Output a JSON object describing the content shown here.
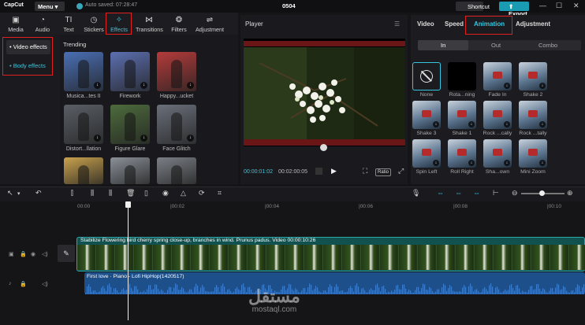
{
  "titlebar": {
    "logo": "CapCut",
    "menu": "Menu",
    "saved": "Auto saved: 07:28:47",
    "title": "0504",
    "shortcut": "Shortcut",
    "export": "Export",
    "min": "—",
    "max": "☐",
    "close": "✕"
  },
  "toolbar": {
    "items": [
      {
        "label": "Media",
        "icon": "media-icon"
      },
      {
        "label": "Audio",
        "icon": "audio-icon"
      },
      {
        "label": "Text",
        "icon": "text-icon"
      },
      {
        "label": "Stickers",
        "icon": "stickers-icon"
      },
      {
        "label": "Effects",
        "icon": "effects-icon",
        "active": true
      },
      {
        "label": "Transitions",
        "icon": "transitions-icon"
      },
      {
        "label": "Filters",
        "icon": "filters-icon"
      },
      {
        "label": "Adjustment",
        "icon": "adjustment-icon"
      }
    ]
  },
  "categories": [
    "• Video effects",
    "• Body effects"
  ],
  "effects": {
    "section": "Trending",
    "items": [
      {
        "label": "Musica...tes II",
        "color": "#4a6fb5"
      },
      {
        "label": "Firework",
        "color": "#5c6fb0"
      },
      {
        "label": "Happy...ucket",
        "color": "#b53b3b"
      },
      {
        "label": "Distort...llation",
        "color": "#5a5f66"
      },
      {
        "label": "Figure Glare",
        "color": "#4d6b3c"
      },
      {
        "label": "Face Glitch",
        "color": "#6a6f7a"
      },
      {
        "label": "",
        "color": "#c9a24d"
      },
      {
        "label": "",
        "color": "#8a9098"
      },
      {
        "label": "",
        "color": "#7b7f86"
      }
    ]
  },
  "player": {
    "title": "Player",
    "time_current": "00:00:01:02",
    "time_total": "00:02:00:05",
    "ratio": "Ratio"
  },
  "properties": {
    "tabs": [
      "Video",
      "Speed",
      "Animation",
      "Adjustment"
    ],
    "active_tab": "Animation",
    "segments": [
      "In",
      "Out",
      "Combo"
    ],
    "animations": [
      "None",
      "Rota...ning",
      "Fade In",
      "Shake 2",
      "Shake 3",
      "Shake 1",
      "Rock ...cally",
      "Rock ...tally",
      "Spin Left",
      "Roll Right",
      "Sha...own",
      "Mini Zoom"
    ]
  },
  "timeline": {
    "ticks": [
      "00:00",
      "|00:02",
      "|00:04",
      "|00:06",
      "|00:08",
      "|00:10"
    ],
    "video_label": "Stabilize   Flowering bird cherry spring close-up, branches in wind. Prunus padus. Video   00:00:10:26",
    "audio_label": "First love  · Piano - Lofi HipHop(1420517)"
  },
  "watermark": {
    "arabic": "مستقل",
    "latin": "mostaql.com"
  },
  "colors": {
    "accent": "#35c7df",
    "highlight": "#e02020",
    "export": "#1a9bb4"
  }
}
